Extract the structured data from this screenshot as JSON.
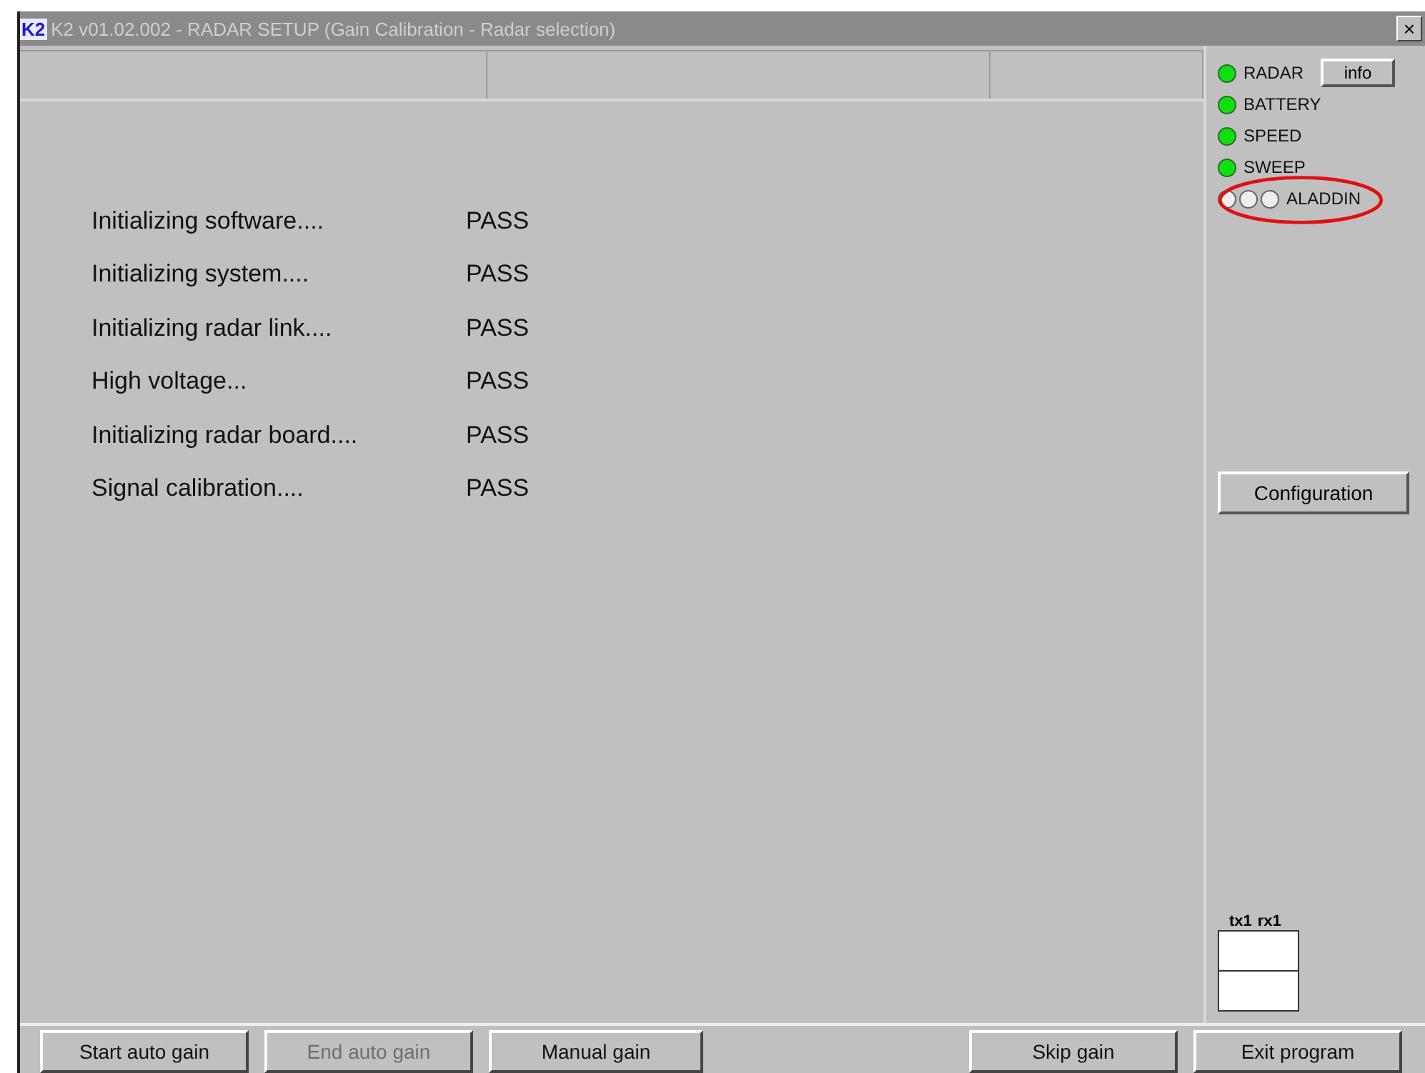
{
  "window": {
    "logo": "K2",
    "title": "K2 v01.02.002 - RADAR SETUP (Gain Calibration - Radar selection)",
    "close": "×"
  },
  "status_panes": [
    {
      "kind": "pane"
    },
    {
      "kind": "pane"
    },
    {
      "kind": "pane"
    }
  ],
  "checks": [
    {
      "label": "Initializing software....",
      "result": "PASS"
    },
    {
      "label": "Initializing system....",
      "result": "PASS"
    },
    {
      "label": "Initializing radar link....",
      "result": "PASS"
    },
    {
      "label": "High voltage...",
      "result": "PASS"
    },
    {
      "label": "Initializing radar board....",
      "result": "PASS"
    },
    {
      "label": "Signal calibration....",
      "result": "PASS"
    }
  ],
  "indicators": [
    {
      "label": "RADAR",
      "lights": [
        {
          "on": true
        }
      ]
    },
    {
      "label": "BATTERY",
      "lights": [
        {
          "on": true
        }
      ]
    },
    {
      "label": "SPEED",
      "lights": [
        {
          "on": true
        }
      ]
    },
    {
      "label": "SWEEP",
      "lights": [
        {
          "on": true
        }
      ]
    },
    {
      "label": "ALADDIN",
      "lights": [
        {
          "on": false
        },
        {
          "on": false
        },
        {
          "on": false
        }
      ],
      "highlighted": true
    }
  ],
  "info_button": "info",
  "config_button": "Configuration",
  "channels": [
    "tx1",
    "rx1"
  ],
  "buttons": [
    {
      "label": "Start auto gain",
      "disabled": false
    },
    {
      "label": "End auto gain",
      "disabled": true
    },
    {
      "label": "Manual gain",
      "disabled": false
    },
    {
      "label": "Skip gain",
      "disabled": false
    },
    {
      "label": "Exit program",
      "disabled": false
    }
  ]
}
